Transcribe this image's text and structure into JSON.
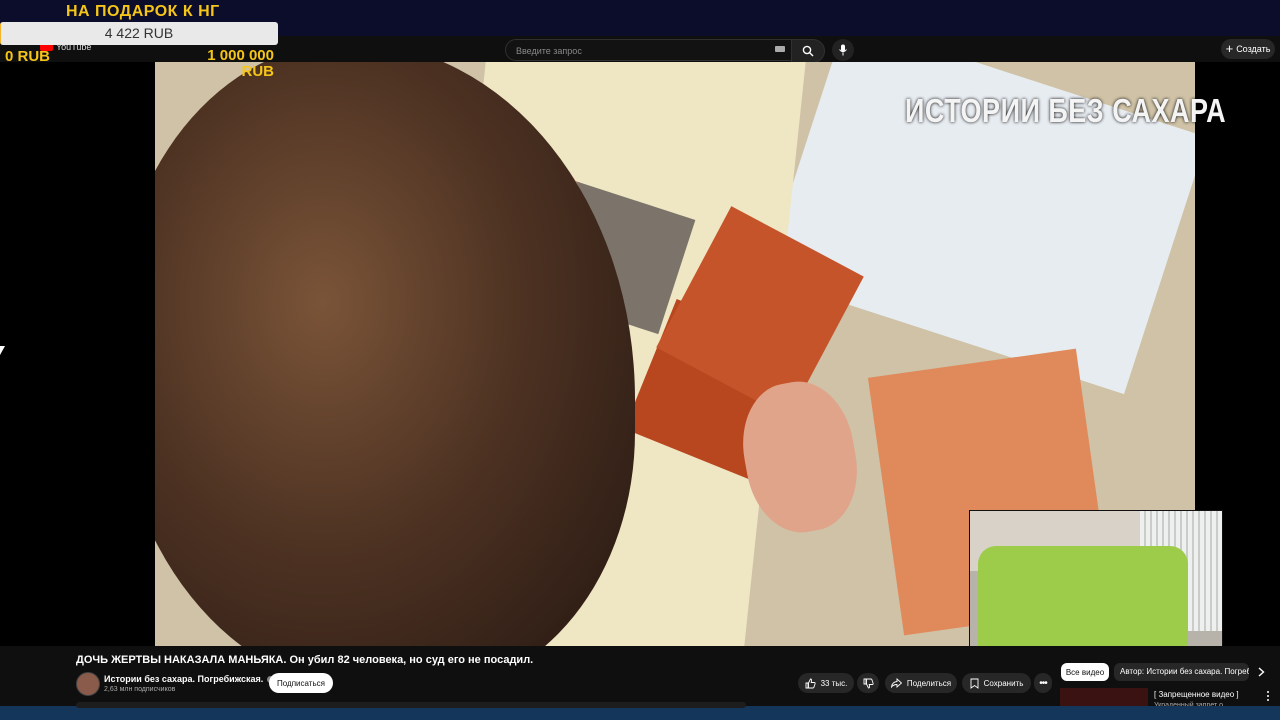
{
  "donation_widget": {
    "title": "НА ПОДАРОК К НГ",
    "current": "4 422  RUB",
    "progress_fraction": 0.0044,
    "min": "0 RUB",
    "max": "1 000 000 RUB",
    "colors": {
      "accent": "#f5c518",
      "bar_bg": "#e9e9e9"
    }
  },
  "youtube_header": {
    "logo_text": "YouTube",
    "search": {
      "placeholder": "Введите запрос",
      "value": ""
    },
    "create_label": "Создать"
  },
  "video": {
    "watermark": "ИСТОРИИ БЕЗ САХАРА",
    "title": "ДОЧЬ ЖЕРТВЫ НАКАЗАЛА МАНЬЯКА. Он убил 82 человека, но суд его не посадил.",
    "channel_name": "Истории без сахара. Погребижская.",
    "subscribers": "2,63 млн подписчиков",
    "subscribe_label": "Подписаться",
    "likes": "33 тыс.",
    "share_label": "Поделиться",
    "save_label": "Сохранить"
  },
  "recommendations": {
    "chips": {
      "all": "Все видео",
      "author": "Автор: Истории без сахара. Погребижская."
    },
    "first": {
      "title": "[ Запрещенное видео ]",
      "subtitle": "Украденный запрет о..."
    }
  }
}
